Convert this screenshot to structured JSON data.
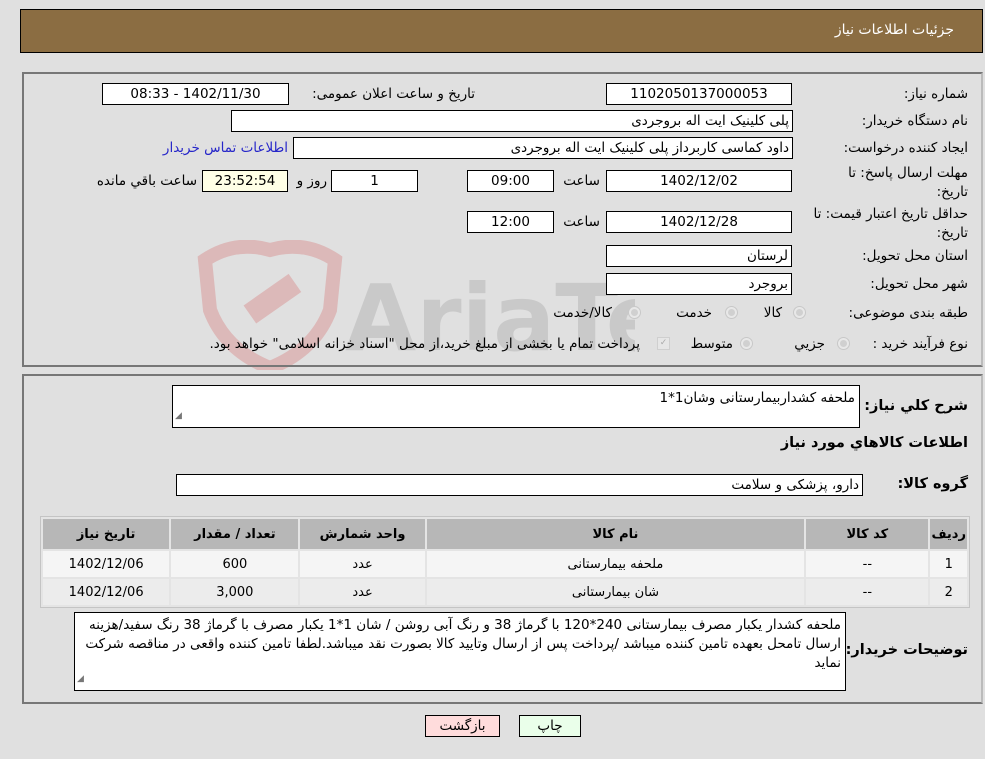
{
  "header": {
    "title": "جزئیات اطلاعات نیاز"
  },
  "form": {
    "need_number": {
      "label": "شماره نیاز:",
      "value": "1102050137000053"
    },
    "announce_datetime": {
      "label": "تاریخ و ساعت اعلان عمومی:",
      "value": "1402/11/30 - 08:33"
    },
    "buyer_org": {
      "label": "نام دستگاه خریدار:",
      "value": "پلی کلینیک ایت اله بروجردی"
    },
    "requester": {
      "label": "ایجاد کننده درخواست:",
      "value": "داود کماسی کاربرداز پلی کلینیک ایت اله بروجردی"
    },
    "buyer_contact_link": "اطلاعات تماس خریدار",
    "response_deadline": {
      "label": "مهلت ارسال پاسخ: تا تاریخ:",
      "date": "1402/12/02",
      "time_label": "ساعت",
      "time": "09:00",
      "days": "1",
      "days_label": "روز و",
      "remaining": "23:52:54",
      "remaining_label": "ساعت باقي مانده"
    },
    "price_validity": {
      "label": "حداقل تاریخ اعتبار قیمت: تا تاریخ:",
      "date": "1402/12/28",
      "time_label": "ساعت",
      "time": "12:00"
    },
    "delivery_province": {
      "label": "استان محل تحویل:",
      "value": "لرستان"
    },
    "delivery_city": {
      "label": "شهر محل تحویل:",
      "value": "بروجرد"
    },
    "category": {
      "label": "طبقه بندی موضوعی:",
      "options": [
        "کالا",
        "خدمت",
        "کالا/خدمت"
      ]
    },
    "purchase_type": {
      "label": "نوع فرآیند خرید :",
      "options": [
        "جزيي",
        "متوسط"
      ],
      "note": "پرداخت تمام یا بخشی از مبلغ خرید،از محل \"اسناد خزانه اسلامی\" خواهد بود."
    }
  },
  "details": {
    "general_desc_label": "شرح كلي نياز:",
    "general_desc": "ملحفه کشداربیمارستانی وشان1*1",
    "goods_info_title": "اطلاعات كالاهاي مورد نياز",
    "goods_group_label": "گروه كالا:",
    "goods_group": "دارو، پزشکی و سلامت",
    "table": {
      "headers": [
        "رديف",
        "كد كالا",
        "نام كالا",
        "واحد شمارش",
        "تعداد / مقدار",
        "تاريخ نياز"
      ],
      "rows": [
        [
          "1",
          "--",
          "ملحفه بیمارستانی",
          "عدد",
          "600",
          "1402/12/06"
        ],
        [
          "2",
          "--",
          "شان بیمارستانی",
          "عدد",
          "3,000",
          "1402/12/06"
        ]
      ]
    },
    "buyer_notes_label": "توضيحات خريدار:",
    "buyer_notes": "ملحفه کشدار یکبار مصرف بیمارستانی 240*120 با گرماژ 38 و رنگ آبی روشن / شان 1*1 یکبار مصرف با گرماژ 38 رنگ سفید/هزینه ارسال تامحل بعهده تامین کننده میباشد /پرداخت پس از ارسال وتایید کالا بصورت نقد میباشد.لطفا تامین کننده واقعی در مناقصه شرکت نماید"
  },
  "buttons": {
    "print": "چاپ",
    "back": "بازگشت"
  },
  "watermark": "AriaTender.neT",
  "colors": {
    "header_bg": "#8b6d42",
    "print_bg": "#eaffea",
    "back_bg": "#ffdcdc",
    "link": "#2626c9"
  }
}
